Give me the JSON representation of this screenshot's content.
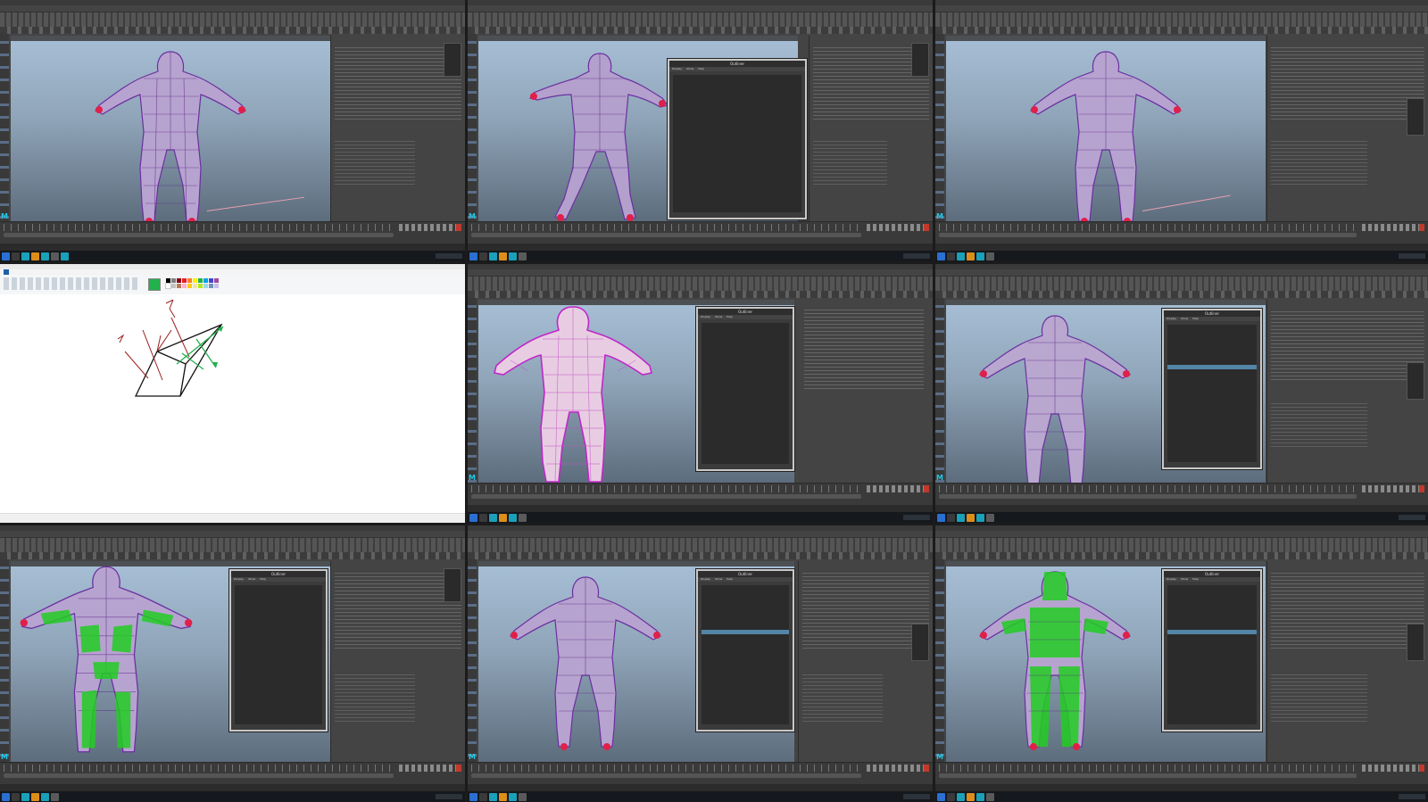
{
  "outliner": {
    "title": "Outliner",
    "menu": [
      "Display",
      "Show",
      "Help"
    ]
  },
  "viewport": {
    "title": "M"
  },
  "colors": {
    "maya_bg": "#444444",
    "viewport_top": "#a7bfd6",
    "wire_purple": "#8a2be2",
    "skin_green": "#22cc22",
    "highlight_blue": "#5285a6",
    "joint_red": "#e0204a"
  }
}
